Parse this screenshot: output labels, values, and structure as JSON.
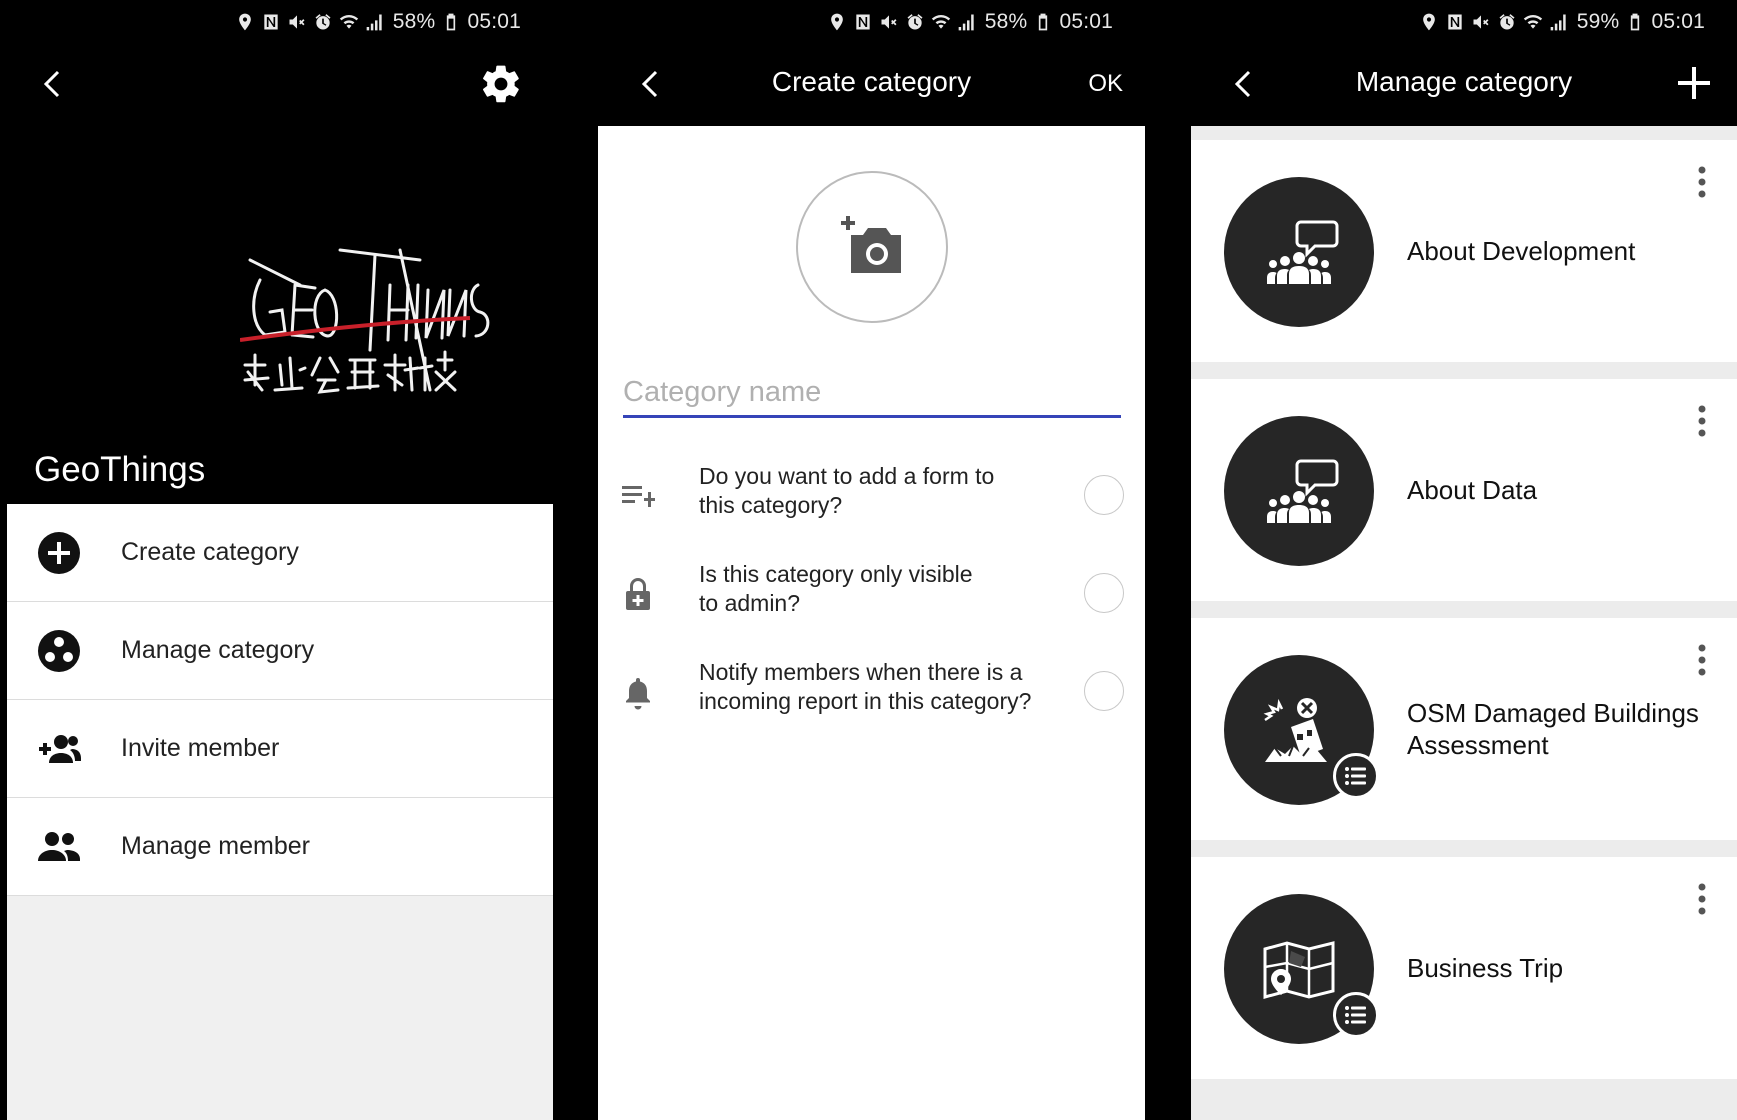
{
  "screen1": {
    "status": {
      "battery": "58%",
      "time": "05:01"
    },
    "app_name": "GeoThings",
    "menu": [
      {
        "label": "Create category",
        "icon": "plus-circle-icon"
      },
      {
        "label": "Manage category",
        "icon": "category-dots-icon"
      },
      {
        "label": "Invite member",
        "icon": "group-add-icon"
      },
      {
        "label": "Manage member",
        "icon": "people-icon"
      }
    ]
  },
  "screen2": {
    "status": {
      "battery": "58%",
      "time": "05:01"
    },
    "title": "Create category",
    "ok_label": "OK",
    "name_placeholder": "Category name",
    "options": [
      {
        "line1": "Do you want to add a form to",
        "line2": "this category?",
        "icon": "playlist-add-icon"
      },
      {
        "line1": "Is this category only visible",
        "line2": "to admin?",
        "icon": "lock-icon"
      },
      {
        "line1": "Notify members when there is a",
        "line2": "incoming report in this category?",
        "icon": "bell-icon"
      }
    ]
  },
  "screen3": {
    "status": {
      "battery": "59%",
      "time": "05:01"
    },
    "title": "Manage category",
    "categories": [
      {
        "line1": "About Development",
        "line2": "",
        "icon": "people-chat-icon",
        "has_form": false
      },
      {
        "line1": "About Data",
        "line2": "",
        "icon": "people-chat-icon",
        "has_form": false
      },
      {
        "line1": "OSM Damaged Buildings",
        "line2": "Assessment",
        "icon": "damaged-building-icon",
        "has_form": true
      },
      {
        "line1": "Business Trip",
        "line2": "",
        "icon": "map-icon",
        "has_form": true
      }
    ]
  },
  "colors": {
    "accent_underline": "#3544b8",
    "dark_avatar": "#262626"
  }
}
